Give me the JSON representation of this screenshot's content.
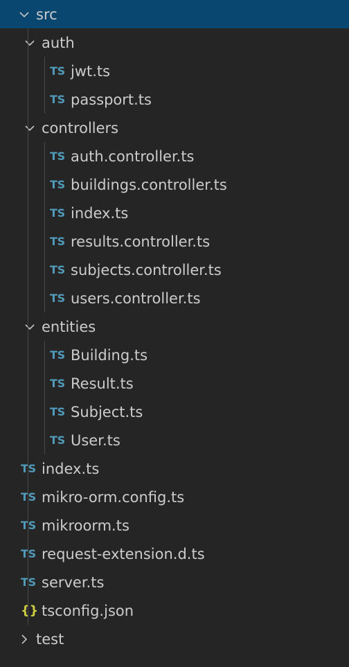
{
  "colors": {
    "background": "#252526",
    "selection": "#094771",
    "text": "#cccccc",
    "ts_icon": "#519aba",
    "json_icon": "#cbcb41",
    "chevron": "#c5c5c5"
  },
  "tree": [
    {
      "label": "src",
      "type": "folder",
      "expanded": true,
      "depth": 0,
      "selected": true,
      "icon": "chevron-down-icon"
    },
    {
      "label": "auth",
      "type": "folder",
      "expanded": true,
      "depth": 1,
      "icon": "chevron-down-icon"
    },
    {
      "label": "jwt.ts",
      "type": "file",
      "badge": "TS",
      "icon": "typescript-file-icon",
      "depth": 2
    },
    {
      "label": "passport.ts",
      "type": "file",
      "badge": "TS",
      "icon": "typescript-file-icon",
      "depth": 2
    },
    {
      "label": "controllers",
      "type": "folder",
      "expanded": true,
      "depth": 1,
      "icon": "chevron-down-icon"
    },
    {
      "label": "auth.controller.ts",
      "type": "file",
      "badge": "TS",
      "icon": "typescript-file-icon",
      "depth": 2
    },
    {
      "label": "buildings.controller.ts",
      "type": "file",
      "badge": "TS",
      "icon": "typescript-file-icon",
      "depth": 2
    },
    {
      "label": "index.ts",
      "type": "file",
      "badge": "TS",
      "icon": "typescript-file-icon",
      "depth": 2
    },
    {
      "label": "results.controller.ts",
      "type": "file",
      "badge": "TS",
      "icon": "typescript-file-icon",
      "depth": 2
    },
    {
      "label": "subjects.controller.ts",
      "type": "file",
      "badge": "TS",
      "icon": "typescript-file-icon",
      "depth": 2
    },
    {
      "label": "users.controller.ts",
      "type": "file",
      "badge": "TS",
      "icon": "typescript-file-icon",
      "depth": 2
    },
    {
      "label": "entities",
      "type": "folder",
      "expanded": true,
      "depth": 1,
      "icon": "chevron-down-icon"
    },
    {
      "label": "Building.ts",
      "type": "file",
      "badge": "TS",
      "icon": "typescript-file-icon",
      "depth": 2
    },
    {
      "label": "Result.ts",
      "type": "file",
      "badge": "TS",
      "icon": "typescript-file-icon",
      "depth": 2
    },
    {
      "label": "Subject.ts",
      "type": "file",
      "badge": "TS",
      "icon": "typescript-file-icon",
      "depth": 2
    },
    {
      "label": "User.ts",
      "type": "file",
      "badge": "TS",
      "icon": "typescript-file-icon",
      "depth": 2
    },
    {
      "label": "index.ts",
      "type": "file",
      "badge": "TS",
      "icon": "typescript-file-icon",
      "depth": 1
    },
    {
      "label": "mikro-orm.config.ts",
      "type": "file",
      "badge": "TS",
      "icon": "typescript-file-icon",
      "depth": 1
    },
    {
      "label": "mikroorm.ts",
      "type": "file",
      "badge": "TS",
      "icon": "typescript-file-icon",
      "depth": 1
    },
    {
      "label": "request-extension.d.ts",
      "type": "file",
      "badge": "TS",
      "icon": "typescript-file-icon",
      "depth": 1
    },
    {
      "label": "server.ts",
      "type": "file",
      "badge": "TS",
      "icon": "typescript-file-icon",
      "depth": 1
    },
    {
      "label": "tsconfig.json",
      "type": "file",
      "badge": "{}",
      "icon": "json-file-icon",
      "depth": 1
    },
    {
      "label": "test",
      "type": "folder",
      "expanded": false,
      "depth": 0,
      "icon": "chevron-right-icon"
    }
  ]
}
